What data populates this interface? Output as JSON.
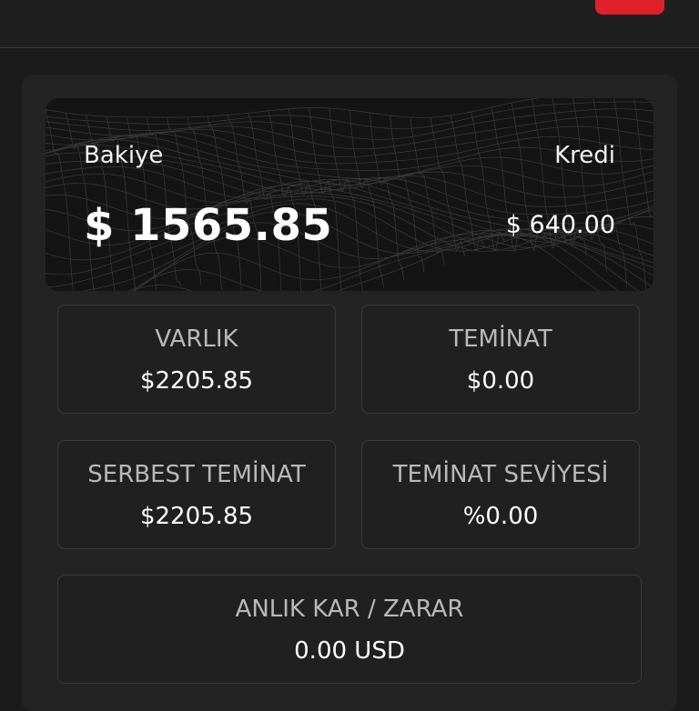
{
  "colors": {
    "accent_red": "#e0202b",
    "background": "#1b1b1b",
    "panel": "#232323",
    "card": "#141414",
    "border": "#3a3a3a"
  },
  "balance_card": {
    "balance_label": "Bakiye",
    "balance_value": "$ 1565.85",
    "credit_label": "Kredi",
    "credit_value": "$ 640.00"
  },
  "stats": {
    "varlik": {
      "label": "VARLIK",
      "value": "$2205.85"
    },
    "teminat": {
      "label": "TEMİNAT",
      "value": "$0.00"
    },
    "serbest_teminat": {
      "label": "SERBEST TEMİNAT",
      "value": "$2205.85"
    },
    "teminat_seviyesi": {
      "label": "TEMİNAT SEVİYESİ",
      "value": "%0.00"
    },
    "anlik_kar_zarar": {
      "label": "ANLIK KAR / ZARAR",
      "value": "0.00 USD"
    }
  }
}
